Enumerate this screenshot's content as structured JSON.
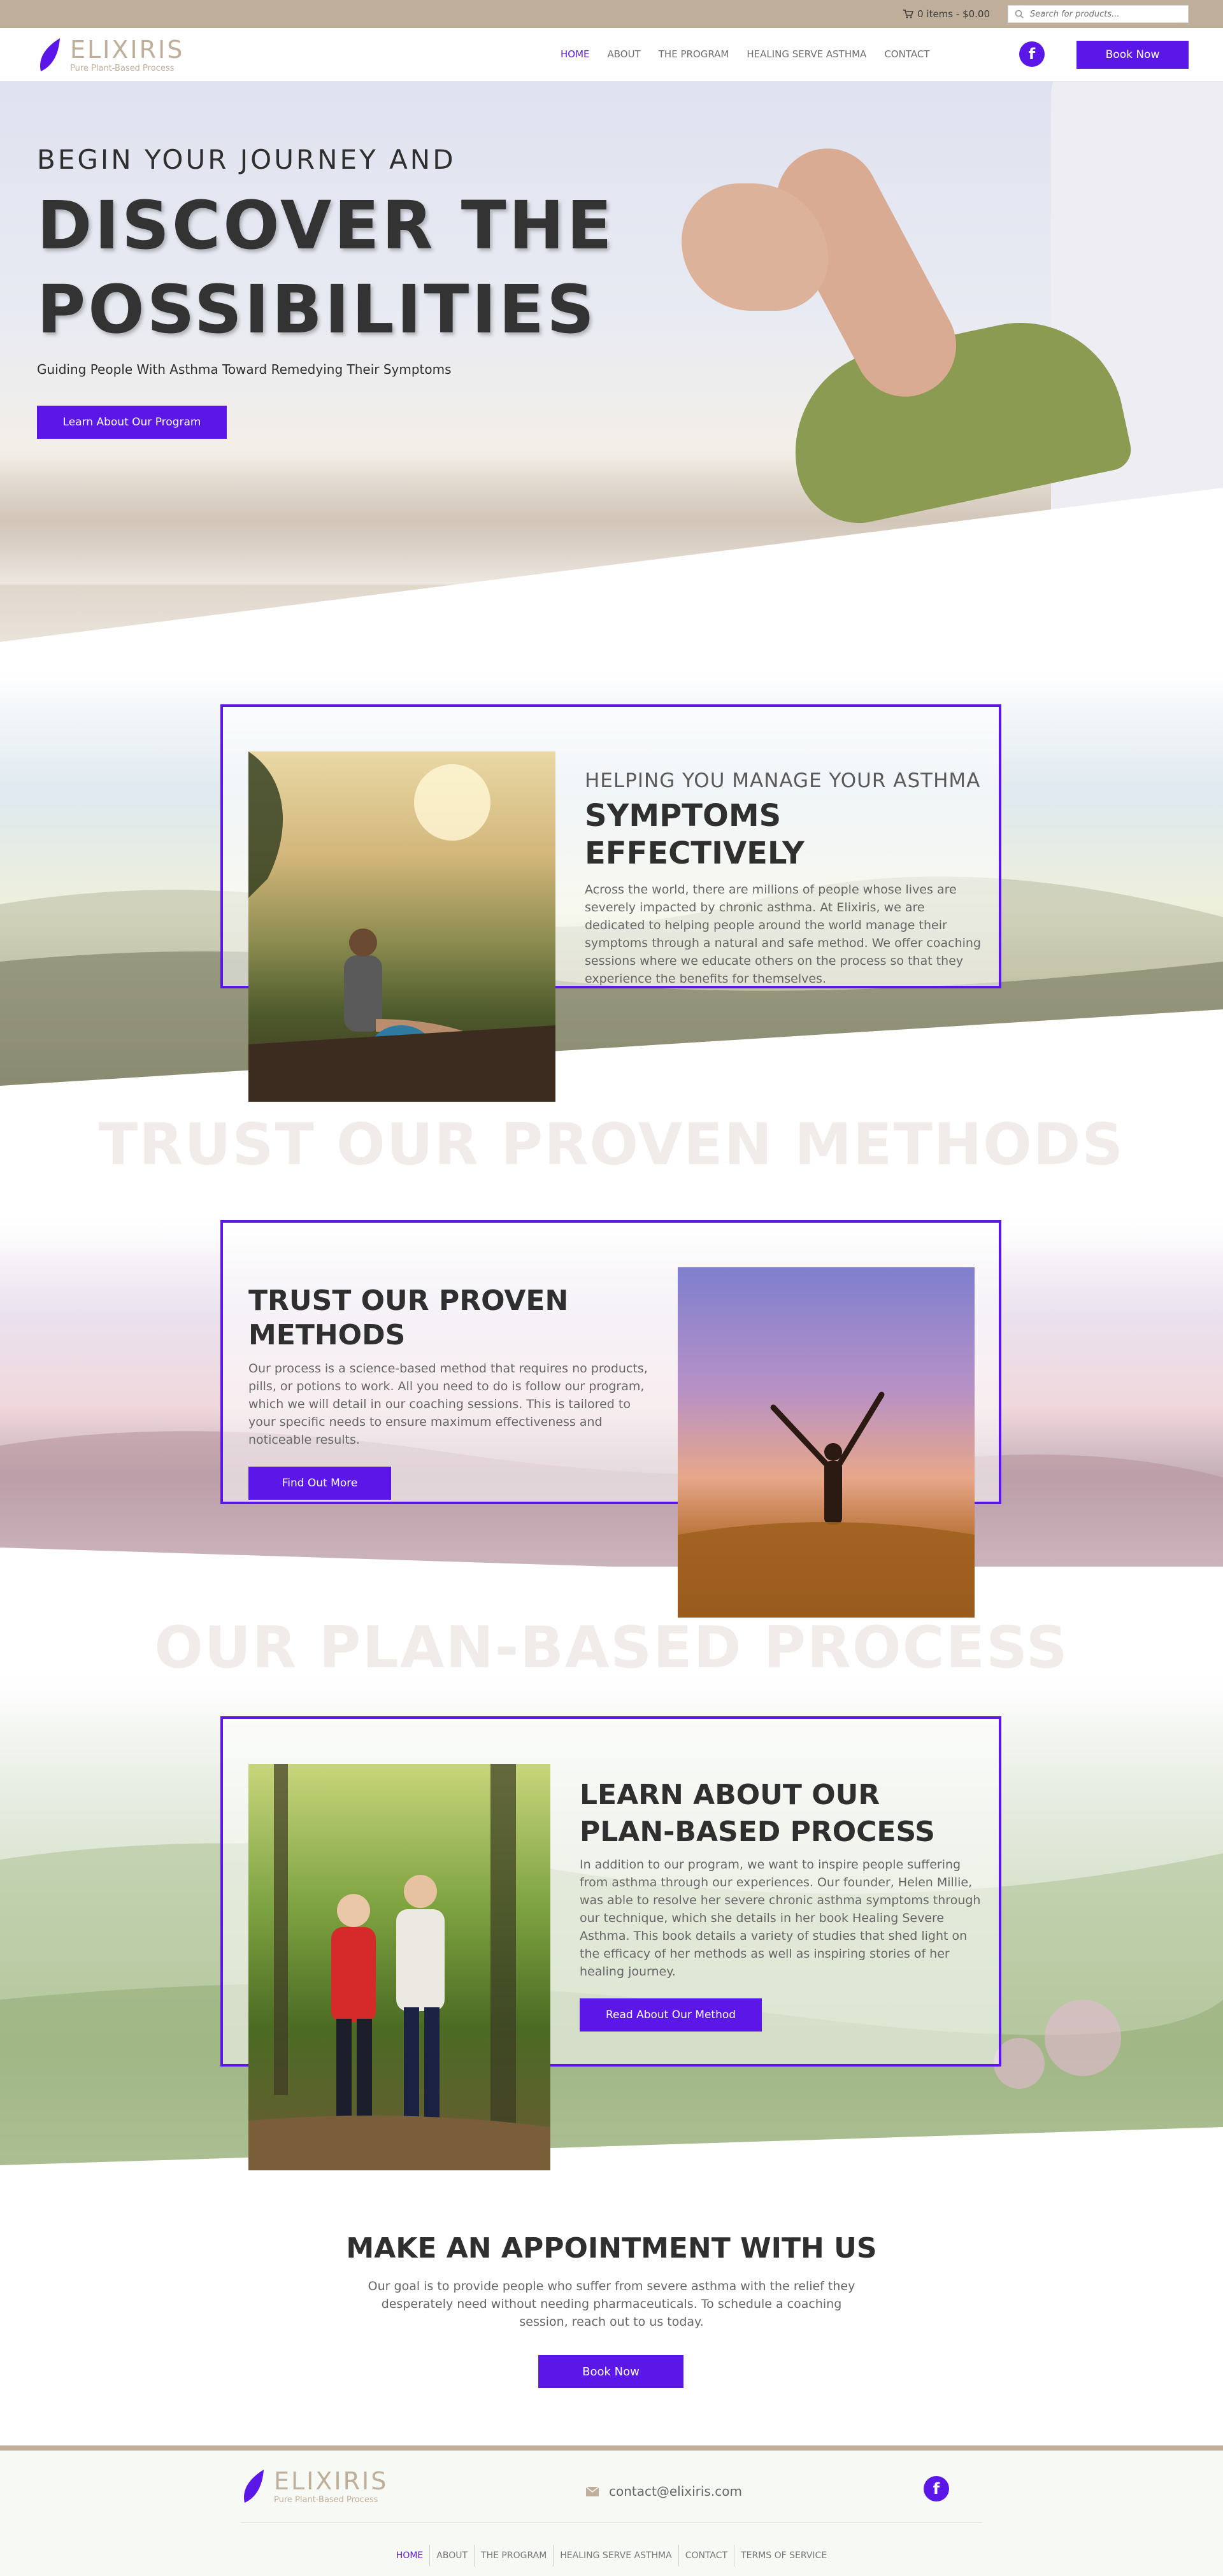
{
  "topbar": {
    "cart_text": "0 items - $0.00",
    "search_placeholder": "Search for products..."
  },
  "brand": {
    "name": "ELIXIRIS",
    "tagline": "Pure Plant-Based Process",
    "color": "#bfae9a",
    "accent": "#5b17e8"
  },
  "nav": {
    "items": [
      {
        "label": "HOME",
        "active": true
      },
      {
        "label": "ABOUT"
      },
      {
        "label": "THE PROGRAM"
      },
      {
        "label": "HEALING SERVE ASTHMA"
      },
      {
        "label": "CONTACT"
      }
    ],
    "book_label": "Book Now",
    "facebook_icon": "facebook-icon"
  },
  "hero": {
    "kicker": "BEGIN YOUR JOURNEY AND",
    "title_line1": "DISCOVER THE",
    "title_line2": "POSSIBILITIES",
    "subtitle": "Guiding People With Asthma Toward Remedying Their Symptoms",
    "cta": "Learn About Our Program"
  },
  "section1": {
    "kicker": "HELPING YOU MANAGE YOUR ASTHMA",
    "title": "SYMPTOMS EFFECTIVELY",
    "body": "Across the world, there are millions of people whose lives are severely impacted by chronic asthma. At Elixiris, we are dedicated to helping people around the world manage their symptoms through a natural and safe method. We offer coaching sessions where we educate others on the process so that they experience the benefits for themselves."
  },
  "ghost1": "TRUST OUR PROVEN METHODS",
  "section2": {
    "title": "TRUST OUR PROVEN METHODS",
    "body": "Our process is a science-based method that requires no products, pills, or potions to work. All you need to do is follow our program, which we will detail in our coaching sessions. This is tailored to your specific needs to ensure maximum effectiveness and noticeable results.",
    "cta": "Find Out More"
  },
  "ghost2": "OUR PLAN-BASED PROCESS",
  "section3": {
    "title_line1": "LEARN ABOUT OUR",
    "title_line2": "PLAN-BASED PROCESS",
    "body": "In addition to our program, we want to inspire people suffering from asthma through our experiences. Our founder, Helen Millie, was able to resolve her severe chronic asthma symptoms through our technique, which she details in her book Healing Severe Asthma. This book details a variety of studies that shed light on the efficacy of her methods as well as inspiring stories of her healing journey.",
    "cta": "Read About Our Method"
  },
  "appointment": {
    "title": "MAKE AN APPOINTMENT WITH US",
    "body": "Our goal is to provide people who suffer from severe asthma with the relief they desperately need without needing pharmaceuticals. To schedule a coaching session, reach out to us today.",
    "cta": "Book Now"
  },
  "footer": {
    "email": "contact@elixiris.com",
    "nav": [
      "HOME",
      "ABOUT",
      "THE PROGRAM",
      "HEALING SERVE ASTHMA",
      "CONTACT",
      "TERMS OF SERVICE"
    ]
  }
}
